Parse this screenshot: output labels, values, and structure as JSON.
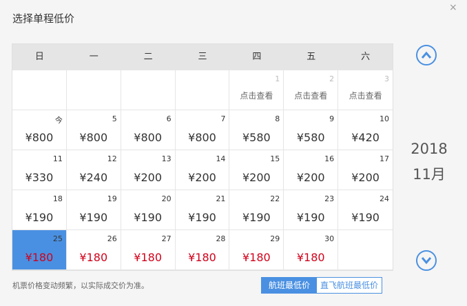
{
  "title": "选择单程低价",
  "close": "×",
  "weekdays": [
    "日",
    "一",
    "二",
    "三",
    "四",
    "五",
    "六"
  ],
  "rows": [
    [
      null,
      null,
      null,
      null,
      {
        "day": "1",
        "label": "点击查看"
      },
      {
        "day": "2",
        "label": "点击查看"
      },
      {
        "day": "3",
        "label": "点击查看"
      }
    ],
    [
      {
        "day": "今",
        "price": "¥800"
      },
      {
        "day": "5",
        "price": "¥800"
      },
      {
        "day": "6",
        "price": "¥800"
      },
      {
        "day": "7",
        "price": "¥800"
      },
      {
        "day": "8",
        "price": "¥580"
      },
      {
        "day": "9",
        "price": "¥580"
      },
      {
        "day": "10",
        "price": "¥420"
      }
    ],
    [
      {
        "day": "11",
        "price": "¥330"
      },
      {
        "day": "12",
        "price": "¥240"
      },
      {
        "day": "13",
        "price": "¥200"
      },
      {
        "day": "14",
        "price": "¥200"
      },
      {
        "day": "15",
        "price": "¥200"
      },
      {
        "day": "16",
        "price": "¥200"
      },
      {
        "day": "17",
        "price": "¥200"
      }
    ],
    [
      {
        "day": "18",
        "price": "¥190"
      },
      {
        "day": "19",
        "price": "¥190"
      },
      {
        "day": "20",
        "price": "¥190"
      },
      {
        "day": "21",
        "price": "¥190"
      },
      {
        "day": "22",
        "price": "¥190"
      },
      {
        "day": "23",
        "price": "¥190"
      },
      {
        "day": "24",
        "price": "¥190"
      }
    ],
    [
      {
        "day": "25",
        "price": "¥180",
        "red": true,
        "selected": true
      },
      {
        "day": "26",
        "price": "¥180",
        "red": true
      },
      {
        "day": "27",
        "price": "¥180",
        "red": true
      },
      {
        "day": "28",
        "price": "¥180",
        "red": true
      },
      {
        "day": "29",
        "price": "¥180",
        "red": true
      },
      {
        "day": "30",
        "price": "¥180",
        "red": true
      },
      null
    ]
  ],
  "year": "2018",
  "month": "11月",
  "note": "机票价格变动频繁，以实际成交价为准。",
  "tabs": {
    "flight_low": "航班最低价",
    "direct_low": "直飞航班最低价"
  },
  "colors": {
    "accent": "#4a90e2",
    "price_red": "#d0021b",
    "header_bg": "#e5e5e5"
  }
}
